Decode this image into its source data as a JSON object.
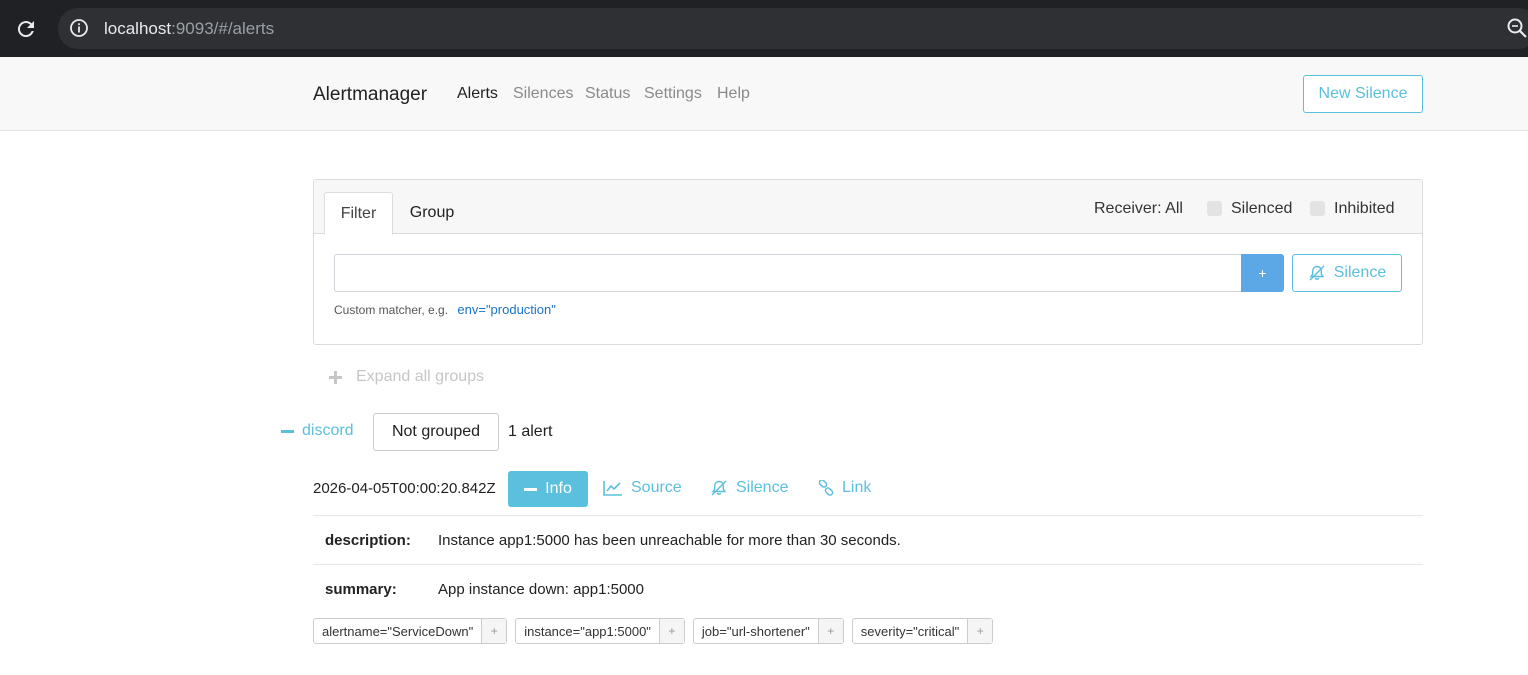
{
  "browser": {
    "url_host": "localhost",
    "url_rest": ":9093/#/alerts"
  },
  "nav": {
    "brand": "Alertmanager",
    "links": [
      "Alerts",
      "Silences",
      "Status",
      "Settings",
      "Help"
    ],
    "active": "Alerts",
    "new_silence": "New Silence"
  },
  "filter_card": {
    "tabs": [
      "Filter",
      "Group"
    ],
    "active_tab": "Filter",
    "receiver": "Receiver: All",
    "silenced_label": "Silenced",
    "inhibited_label": "Inhibited",
    "matcher_value": "",
    "add_label": "+",
    "silence_label": "Silence",
    "hint": "Custom matcher, e.g.",
    "hint_example": "env=\"production\""
  },
  "expand_all": "Expand all groups",
  "group": {
    "receiver": "discord",
    "grouping": "Not grouped",
    "count": "1 alert"
  },
  "alert": {
    "starts_at": "2026-04-05T00:00:20.842Z",
    "info_label": "Info",
    "source_label": "Source",
    "silence_label": "Silence",
    "link_label": "Link",
    "annotations": [
      {
        "key": "description:",
        "value": "Instance app1:5000 has been unreachable for more than 30 seconds."
      },
      {
        "key": "summary:",
        "value": "App instance down: app1:5000"
      }
    ],
    "labels": [
      "alertname=\"ServiceDown\"",
      "instance=\"app1:5000\"",
      "job=\"url-shortener\"",
      "severity=\"critical\""
    ],
    "label_add": "+"
  },
  "colors": {
    "accent": "#5bc0de",
    "primary": "#5ca7e6",
    "chrome": "#202124"
  }
}
